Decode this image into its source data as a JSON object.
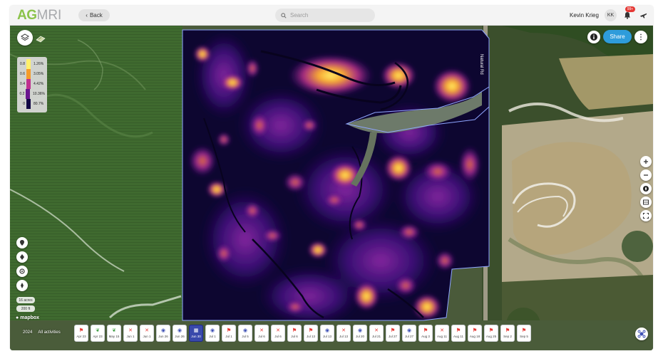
{
  "header": {
    "logo_part1": "AG",
    "logo_part2": "MRI",
    "back_label": "Back",
    "search_placeholder": "Search",
    "user_name": "Kevin Krieg",
    "user_initials": "KK",
    "notification_count": "99+"
  },
  "map": {
    "share_label": "Share",
    "more_label": "⋮",
    "legend": [
      {
        "label": "0.8",
        "percent": "1.26%",
        "color": "#fff06a"
      },
      {
        "label": "0.6",
        "percent": "3.05%",
        "color": "#f59b2a"
      },
      {
        "label": "0.4",
        "percent": "4.42%",
        "color": "#c02f8f"
      },
      {
        "label": "0.2",
        "percent": "10.36%",
        "color": "#6a168f"
      },
      {
        "label": "0",
        "percent": "80.7%",
        "color": "#120845"
      }
    ],
    "scale_top": "16 acres",
    "scale_bottom": "200 ft",
    "mapbox_label": "mapbox",
    "road_label": "Natural Rd",
    "colors": {
      "share": "#2e9cdb",
      "active_date": "#3949ab",
      "heat_low": "#0d0630",
      "heat_high": "#fff06a"
    }
  },
  "timeline": {
    "year": "2024",
    "filter": "All activities",
    "items": [
      {
        "date": "Apr 23",
        "icon": "scout",
        "active": false
      },
      {
        "date": "Apr 23",
        "icon": "plant",
        "active": false
      },
      {
        "date": "May 15",
        "icon": "plant",
        "active": false
      },
      {
        "date": "Jun 1",
        "icon": "x",
        "active": false
      },
      {
        "date": "Jun 1",
        "icon": "x",
        "active": false
      },
      {
        "date": "Jun 26",
        "icon": "img",
        "active": false
      },
      {
        "date": "Jun 26",
        "icon": "img",
        "active": false
      },
      {
        "date": "Jun 30",
        "icon": "grid",
        "active": true
      },
      {
        "date": "Jul 1",
        "icon": "img",
        "active": false
      },
      {
        "date": "Jul 1",
        "icon": "scout",
        "active": false
      },
      {
        "date": "Jul 5",
        "icon": "img",
        "active": false
      },
      {
        "date": "Jul 6",
        "icon": "x",
        "active": false
      },
      {
        "date": "Jul 6",
        "icon": "x",
        "active": false
      },
      {
        "date": "Jul 6",
        "icon": "scout",
        "active": false
      },
      {
        "date": "Jul 13",
        "icon": "scout",
        "active": false
      },
      {
        "date": "Jul 13",
        "icon": "img",
        "active": false
      },
      {
        "date": "Jul 13",
        "icon": "x",
        "active": false
      },
      {
        "date": "Jul 20",
        "icon": "img",
        "active": false
      },
      {
        "date": "Jul 21",
        "icon": "x",
        "active": false
      },
      {
        "date": "Jul 27",
        "icon": "scout",
        "active": false
      },
      {
        "date": "Jul 27",
        "icon": "img",
        "active": false
      },
      {
        "date": "Aug 3",
        "icon": "scout",
        "active": false
      },
      {
        "date": "Aug 11",
        "icon": "x",
        "active": false
      },
      {
        "date": "Aug 11",
        "icon": "scout",
        "active": false
      },
      {
        "date": "Aug 18",
        "icon": "scout",
        "active": false
      },
      {
        "date": "Aug 25",
        "icon": "scout",
        "active": false
      },
      {
        "date": "Sep 2",
        "icon": "scout",
        "active": false
      },
      {
        "date": "Sep 5",
        "icon": "scout",
        "active": false
      }
    ]
  }
}
